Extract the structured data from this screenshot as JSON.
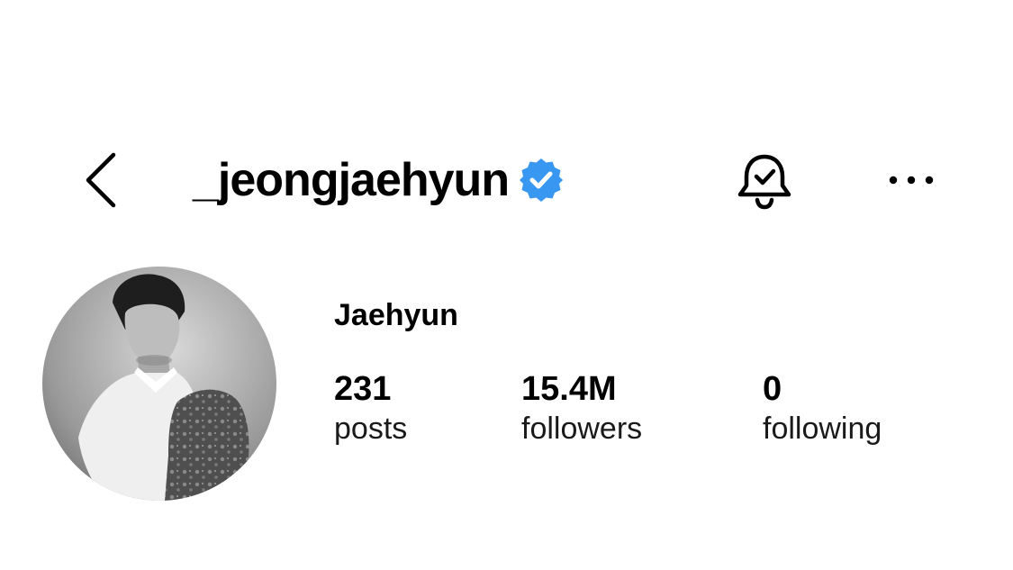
{
  "header": {
    "username": "_jeongjaehyun",
    "verified": true,
    "icons": {
      "back": "chevron-left-icon",
      "verified": "verified-badge-icon",
      "notifications": "bell-check-icon",
      "more": "more-horizontal-icon"
    }
  },
  "profile": {
    "display_name": "Jaehyun",
    "avatar": "profile photo, black and white portrait",
    "stats": {
      "posts": {
        "count": "231",
        "label": "posts"
      },
      "followers": {
        "count": "15.4M",
        "label": "followers"
      },
      "following": {
        "count": "0",
        "label": "following"
      }
    }
  },
  "colors": {
    "background": "#ffffff",
    "text": "#000000",
    "verified_blue": "#3897f0"
  }
}
